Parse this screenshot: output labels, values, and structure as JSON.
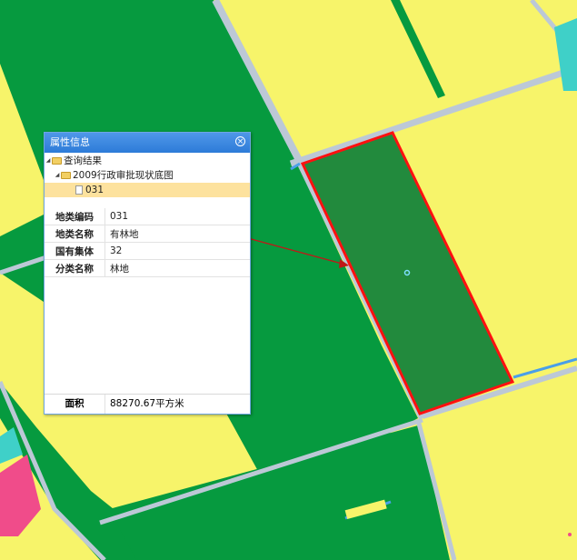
{
  "panel": {
    "title": "属性信息",
    "close_symbol": "×",
    "tree": {
      "root_label": "查询结果",
      "layer_label": "2009行政审批现状底图",
      "item_label": "031"
    },
    "attributes": [
      {
        "key": "地类编码",
        "value": "031"
      },
      {
        "key": "地类名称",
        "value": "有林地"
      },
      {
        "key": "国有集体",
        "value": "32"
      },
      {
        "key": "分类名称",
        "value": "林地"
      }
    ],
    "area": {
      "key": "面积",
      "value": "88270.67平方米"
    }
  },
  "map": {
    "colors": {
      "forest": "#069a3f",
      "farmland": "#f7f46a",
      "road": "#bcc8d6",
      "highlight_fill": "#228a3d",
      "highlight_border": "#ff1010",
      "water": "#4a9fe8",
      "residential": "#f04c8a",
      "cyan": "#3fd0c8"
    },
    "icons": [
      "close-icon",
      "folder-icon",
      "file-icon",
      "location-pin-icon"
    ]
  }
}
